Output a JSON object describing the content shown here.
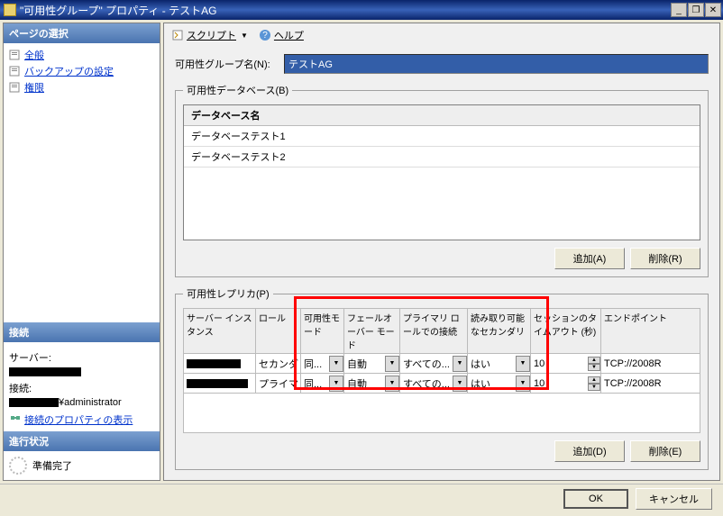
{
  "title_bar": {
    "icon": "db-icon",
    "title": "\"可用性グループ\" プロパティ - テストAG",
    "min": "_",
    "max": "❐",
    "close": "✕"
  },
  "sidebar": {
    "header_pages": "ページの選択",
    "items": [
      {
        "icon": "page",
        "label": "全般"
      },
      {
        "icon": "page",
        "label": "バックアップの設定"
      },
      {
        "icon": "page",
        "label": "権限"
      }
    ],
    "header_conn": "接続",
    "server_label": "サーバー:",
    "conn_label": "接続:",
    "conn_suffix": "¥administrator",
    "view_props": "接続のプロパティの表示",
    "header_progress": "進行状況",
    "progress_text": "準備完了"
  },
  "toolbar": {
    "script": "スクリプト",
    "help": "ヘルプ"
  },
  "form": {
    "group_name_label": "可用性グループ名(N):",
    "group_name_value": "テストAG",
    "db_legend": "可用性データベース(B)",
    "db_header": "データベース名",
    "db_rows": [
      "データベーステスト1",
      "データベーステスト2"
    ],
    "btn_add_a": "追加(A)",
    "btn_del_r": "削除(R)",
    "replica_legend": "可用性レプリカ(P)",
    "replica_headers": {
      "server": "サーバー インスタンス",
      "role": "ロール",
      "avail": "可用性モード",
      "failover": "フェールオーバー モード",
      "primary": "プライマリ ロールでの接続",
      "readonly": "読み取り可能なセカンダリ",
      "timeout": "セッションのタイムアウト (秒)",
      "endpoint": "エンドポイント"
    },
    "replica_rows": [
      {
        "role": "セカンダリ",
        "avail": "同...",
        "failover": "自動",
        "primary": "すべての...",
        "readonly": "はい",
        "timeout": "10",
        "endpoint": "TCP://2008R"
      },
      {
        "role": "プライマリ",
        "avail": "同...",
        "failover": "自動",
        "primary": "すべての...",
        "readonly": "はい",
        "timeout": "10",
        "endpoint": "TCP://2008R"
      }
    ],
    "btn_add_d": "追加(D)",
    "btn_del_e": "削除(E)"
  },
  "bottom": {
    "ok": "OK",
    "cancel": "キャンセル"
  }
}
